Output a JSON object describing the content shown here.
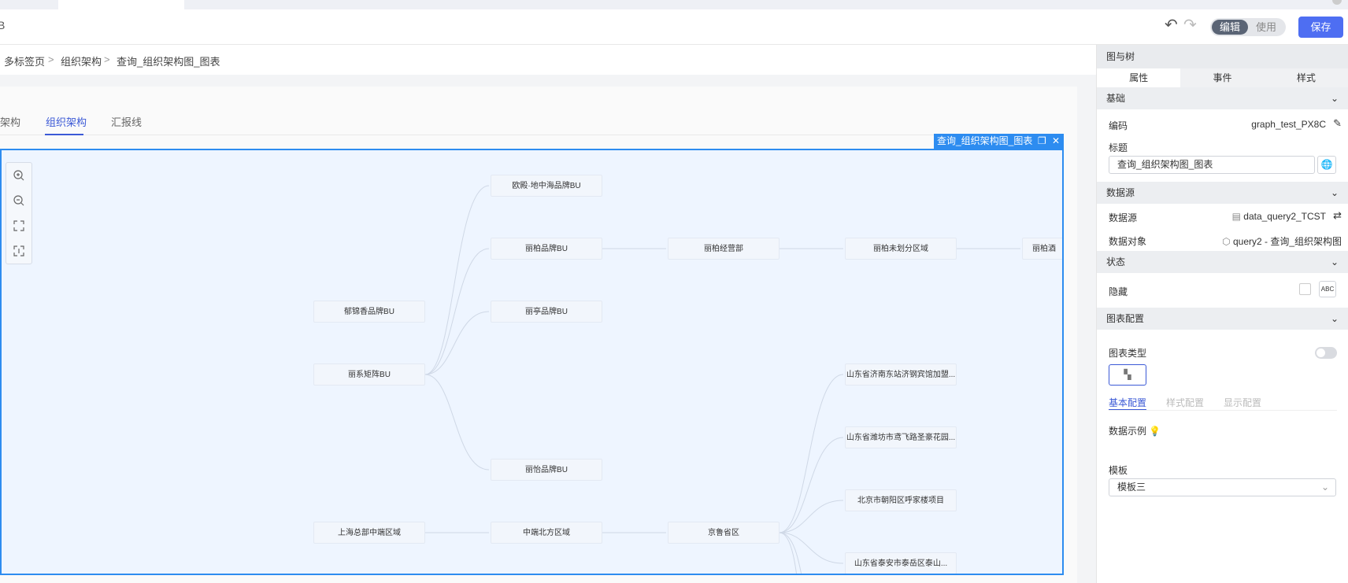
{
  "header": {
    "title_cut": "B",
    "mode_edit": "编辑",
    "mode_use": "使用",
    "save_label": "保存"
  },
  "breadcrumb": {
    "items": [
      "多标签页",
      "组织架构",
      "查询_组织架构图_图表"
    ],
    "sep": ">"
  },
  "tabs": [
    {
      "label": "架构"
    },
    {
      "label": "组织架构"
    },
    {
      "label": "汇报线"
    }
  ],
  "selected_component": {
    "label": "查询_组织架构图_图表"
  },
  "tree_nodes": [
    {
      "label": "欧殿·地中海品牌BU"
    },
    {
      "label": "丽柏品牌BU"
    },
    {
      "label": "丽柏经营部"
    },
    {
      "label": "丽柏未划分区域"
    },
    {
      "label": "丽柏酒"
    },
    {
      "label": "郁锦香品牌BU"
    },
    {
      "label": "丽亭品牌BU"
    },
    {
      "label": "丽系矩阵BU"
    },
    {
      "label": "山东省济南东站济钢宾馆加盟..."
    },
    {
      "label": "山东省潍坊市鸢飞路圣豪花园..."
    },
    {
      "label": "丽怡品牌BU"
    },
    {
      "label": "北京市朝阳区呼家楼项目"
    },
    {
      "label": "上海总部中端区域"
    },
    {
      "label": "中端北方区域"
    },
    {
      "label": "京鲁省区"
    },
    {
      "label": "山东省泰安市泰岳区泰山..."
    }
  ],
  "panel": {
    "title": "图与树",
    "tabs": [
      "属性",
      "事件",
      "样式"
    ],
    "sections": {
      "basic": "基础",
      "datasource": "数据源",
      "state": "状态",
      "chart_config": "图表配置"
    },
    "code_label": "编码",
    "code_value": "graph_test_PX8C",
    "title_label": "标题",
    "title_value": "查询_组织架构图_图表",
    "ds_label": "数据源",
    "ds_value": "data_query2_TCST",
    "dobj_label": "数据对象",
    "dobj_value": "query2 - 查询_组织架构图",
    "hidden_label": "隐藏",
    "abc": "ABC",
    "chart_type_label": "图表类型",
    "subtabs": [
      "基本配置",
      "样式配置",
      "显示配置"
    ],
    "data_example_label": "数据示例",
    "template_label": "模板",
    "template_value": "模板三"
  },
  "colors": {
    "primary": "#4e6ef2",
    "selection": "#2d8cf0",
    "active_tab": "#3b59d6"
  }
}
